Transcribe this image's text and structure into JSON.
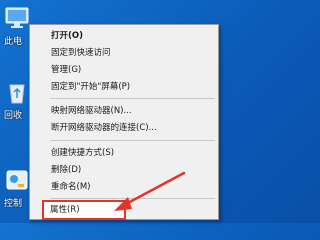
{
  "desktop": {
    "icons": [
      {
        "label": "此电",
        "icon": "computer-icon"
      },
      {
        "label": "回收",
        "icon": "recycle-bin-icon"
      },
      {
        "label": "控制",
        "icon": "control-panel-icon"
      }
    ]
  },
  "context_menu": {
    "items": [
      {
        "label": "打开(O)",
        "bold": true
      },
      {
        "label": "固定到快速访问"
      },
      {
        "label": "管理(G)"
      },
      {
        "label": "固定到\"开始\"屏幕(P)"
      },
      {
        "label": "映射网络驱动器(N)..."
      },
      {
        "label": "断开网络驱动器的连接(C)..."
      },
      {
        "label": "创建快捷方式(S)"
      },
      {
        "label": "删除(D)"
      },
      {
        "label": "重命名(M)"
      },
      {
        "label": "属性(R)",
        "highlighted": true
      }
    ]
  },
  "colors": {
    "desktop": "#0b5bb8",
    "menu_bg": "#f0f0f0",
    "annotation": "#e53329"
  }
}
